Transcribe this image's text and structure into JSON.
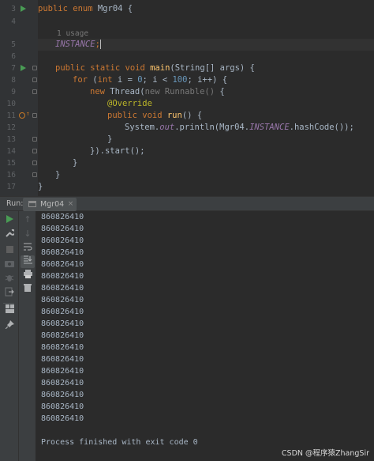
{
  "editor": {
    "lines": [
      {
        "num": "3"
      },
      {
        "num": "4"
      },
      {
        "num": ""
      },
      {
        "num": "5"
      },
      {
        "num": "6"
      },
      {
        "num": "7"
      },
      {
        "num": "8"
      },
      {
        "num": "9"
      },
      {
        "num": "10"
      },
      {
        "num": "11"
      },
      {
        "num": "12"
      },
      {
        "num": "13"
      },
      {
        "num": "14"
      },
      {
        "num": "15"
      },
      {
        "num": "16"
      },
      {
        "num": "17"
      },
      {
        "num": "18"
      }
    ],
    "code": {
      "l3_kw": "public enum ",
      "l3_rest": "Mgr04 {",
      "usage_hint": "1 usage",
      "l5_instance": "INSTANCE",
      "l5_semi": ";",
      "l7_kw": "public static void ",
      "l7_fn": "main",
      "l7_rest": "(String[] args) {",
      "l8_for": "for ",
      "l8_open": "(",
      "l8_int": "int ",
      "l8_i": "i = ",
      "l8_zero": "0",
      "l8_mid": "; i < ",
      "l8_hundred": "100",
      "l8_end": "; i++) {",
      "l9_new": "new ",
      "l9_thread": "Thread(",
      "l9_hint": "new Runnable() ",
      "l9_brace": "{",
      "l10_ann": "@Override",
      "l11_kw": "public void ",
      "l11_fn": "run",
      "l11_rest": "() {",
      "l12_sys": "System.",
      "l12_out": "out",
      "l12_mid": ".println(Mgr04.",
      "l12_inst": "INSTANCE",
      "l12_end": ".hashCode());",
      "l13": "}",
      "l14": "}).start();",
      "l16": "}",
      "l17": "}",
      "l18": "}"
    }
  },
  "run_panel": {
    "label": "Run:",
    "tab_label": "Mgr04",
    "tab_close": "×",
    "output": [
      "860826410",
      "860826410",
      "860826410",
      "860826410",
      "860826410",
      "860826410",
      "860826410",
      "860826410",
      "860826410",
      "860826410",
      "860826410",
      "860826410",
      "860826410",
      "860826410",
      "860826410",
      "860826410",
      "860826410",
      "860826410"
    ],
    "exit_message": "Process finished with exit code 0"
  },
  "icons": {
    "rerun": "rerun-icon",
    "wrench": "wrench-icon",
    "stop": "stop-icon",
    "camera": "camera-icon",
    "debug": "debug-icon",
    "exit": "exit-icon",
    "layout": "layout-icon",
    "pin": "pin-icon",
    "up": "up-arrow-icon",
    "down": "down-arrow-icon",
    "soft_wrap": "soft-wrap-icon",
    "scroll_end": "scroll-to-end-icon",
    "print": "print-icon",
    "trash": "trash-icon"
  },
  "colors": {
    "run_green": "#499c54",
    "keyword": "#cc7832",
    "number": "#6897bb",
    "annotation": "#bbb529",
    "field": "#9876aa",
    "method": "#ffc66d",
    "override_marker": "#c57825"
  },
  "watermark": "CSDN @程序猿ZhangSir"
}
